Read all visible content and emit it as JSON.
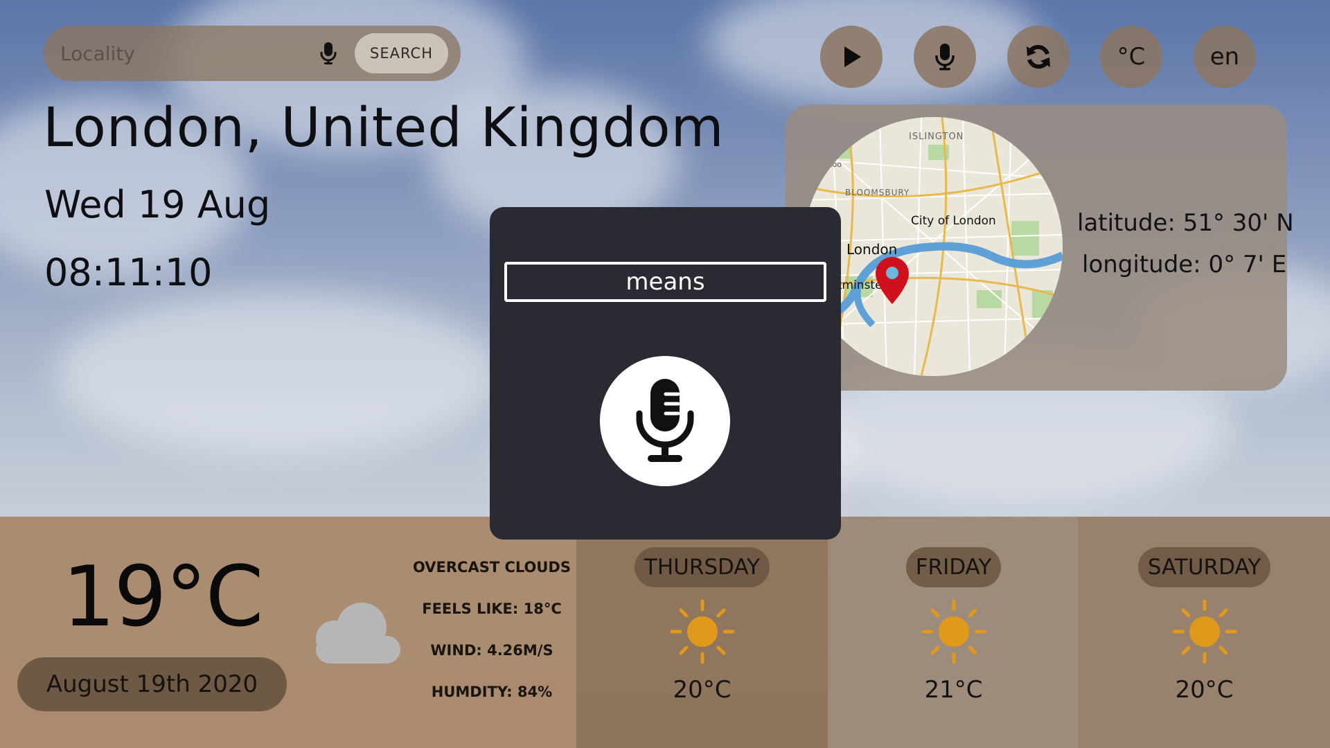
{
  "search": {
    "placeholder": "Locality",
    "button_label": "SEARCH",
    "mic_icon": "microphone-icon"
  },
  "controls": {
    "play_icon": "play-icon",
    "mic_icon": "microphone-icon",
    "refresh_icon": "refresh-icon",
    "unit_label": "°C",
    "language_label": "en"
  },
  "location": {
    "city": "London, United Kingdom",
    "date": "Wed 19 Aug",
    "time": "08:11:10"
  },
  "map": {
    "latitude": "latitude: 51° 30' N",
    "longitude": "longitude: 0° 7' E",
    "labels": {
      "islington": "ISLINGTON",
      "bloomsbury": "BLOOMSBURY",
      "zoo": "Zoo",
      "city": "City of London",
      "london": "London",
      "westminster": "stminste"
    },
    "pin_color": "#d0101a"
  },
  "current": {
    "temperature": "19°C",
    "date": "August 19th 2020",
    "condition": "OVERCAST CLOUDS",
    "feels_like": "FEELS LIKE: 18°C",
    "wind": "WIND: 4.26M/S",
    "humidity": "HUMDITY: 84%",
    "icon": "cloud-icon"
  },
  "forecast": [
    {
      "day": "THURSDAY",
      "temp": "20°C",
      "icon": "sun-icon"
    },
    {
      "day": "FRIDAY",
      "temp": "21°C",
      "icon": "sun-icon"
    },
    {
      "day": "SATURDAY",
      "temp": "20°C",
      "icon": "sun-icon"
    }
  ],
  "voice_modal": {
    "transcript": "means",
    "mic_icon": "microphone-icon"
  },
  "colors": {
    "modal_bg": "#2a2a33",
    "sun": "#e0991a",
    "panel": "#a58262"
  }
}
